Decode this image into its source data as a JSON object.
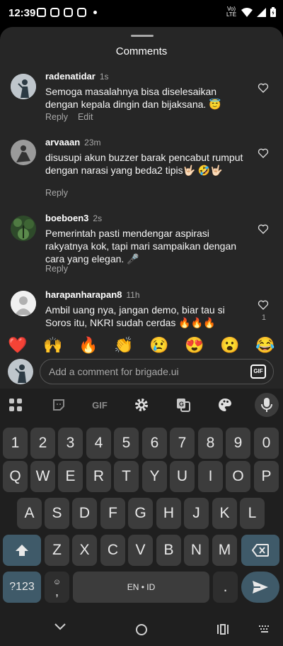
{
  "status_bar": {
    "time": "12:39",
    "network": "Vo) LTE"
  },
  "sheet": {
    "title": "Comments"
  },
  "comments": [
    {
      "user": "radenatidar",
      "time": "1s",
      "text": "Semoga masalahnya bisa diselesaikan dengan kepala dingin dan bijaksana. 😇",
      "actions": [
        "Reply",
        "Edit"
      ],
      "likes": ""
    },
    {
      "user": "arvaaan",
      "time": "23m",
      "text": "disusupi akun buzzer barak pencabut rumput dengan narasi yang beda2 tipis🤟🏻 🤣🤟🏻",
      "actions": [
        "Reply"
      ],
      "likes": ""
    },
    {
      "user": "boeboen3",
      "time": "2s",
      "text": "Pemerintah pasti mendengar aspirasi rakyatnya kok, tapi mari sampaikan dengan cara yang elegan. 🎤",
      "actions": [
        "Reply"
      ],
      "likes": ""
    },
    {
      "user": "harapanharapan8",
      "time": "11h",
      "text": "Ambil uang nya, jangan demo, biar tau si Soros itu, NKRI sudah cerdas 🔥🔥🔥",
      "actions": [],
      "likes": "1"
    }
  ],
  "quick_emojis": [
    "❤️",
    "🙌",
    "🔥",
    "👏",
    "😢",
    "😍",
    "😮",
    "😂"
  ],
  "composer": {
    "placeholder": "Add a comment for brigade.ui",
    "gif_label": "GIF"
  },
  "keyboard": {
    "toolbar": {
      "gif_label": "GIF"
    },
    "row_numbers": [
      "1",
      "2",
      "3",
      "4",
      "5",
      "6",
      "7",
      "8",
      "9",
      "0"
    ],
    "row_1": [
      "Q",
      "W",
      "E",
      "R",
      "T",
      "Y",
      "U",
      "I",
      "O",
      "P"
    ],
    "row_2": [
      "A",
      "S",
      "D",
      "F",
      "G",
      "H",
      "J",
      "K",
      "L"
    ],
    "row_3": [
      "Z",
      "X",
      "C",
      "V",
      "B",
      "N",
      "M"
    ],
    "symbols_label": "?123",
    "comma_label": ",",
    "space_label": "EN • ID",
    "period_label": "."
  },
  "colors": {
    "sheet_bg": "#262626",
    "keyboard_bg": "#1f1f1f",
    "key_bg": "#3c3c3c",
    "accent_key": "#3f5a69",
    "secondary_text": "#a8a8a8"
  }
}
